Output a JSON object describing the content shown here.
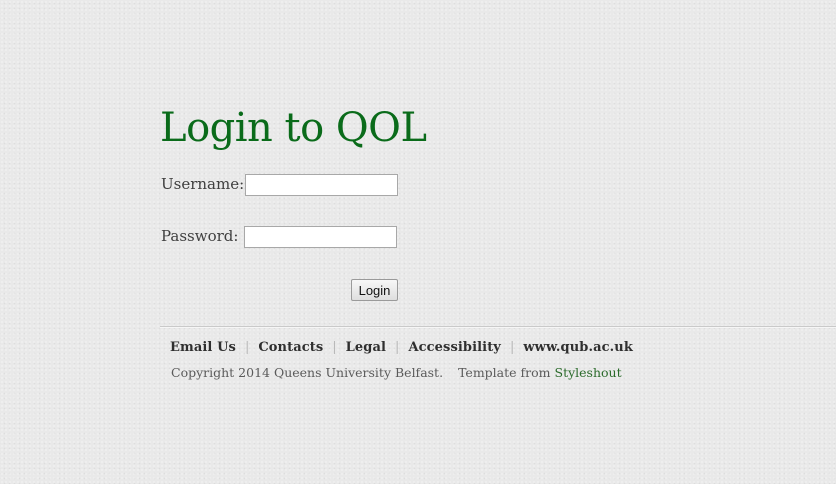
{
  "page": {
    "title": "Login to QOL"
  },
  "login_form": {
    "username_label": "Username:",
    "username_value": "",
    "password_label": "Password:",
    "password_value": "",
    "submit_label": "Login"
  },
  "footer": {
    "nav": [
      {
        "label": "Email Us"
      },
      {
        "label": "Contacts"
      },
      {
        "label": "Legal"
      },
      {
        "label": "Accessibility"
      },
      {
        "label": "www.qub.ac.uk"
      }
    ],
    "separator": "|",
    "copyright": "Copyright 2014 Queens University Belfast.",
    "template_prefix": "Template from",
    "template_link": "Styleshout"
  },
  "colors": {
    "title": "#0a6b1a",
    "link": "#2a6a2a",
    "background": "#e9e9e9"
  }
}
